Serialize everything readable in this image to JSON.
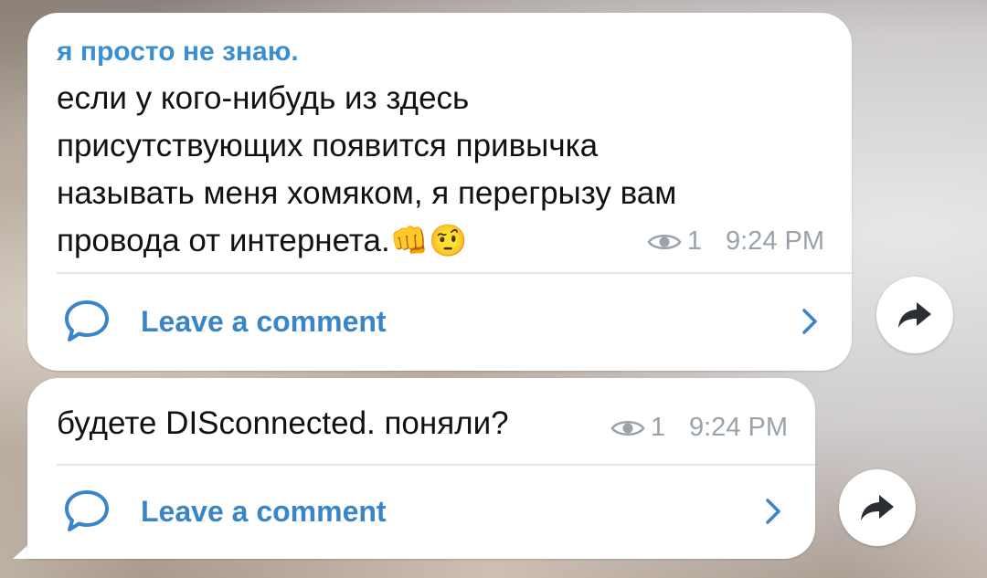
{
  "colors": {
    "author": "#3b8fd1",
    "link": "#3a85c7",
    "meta": "#9aa3ab",
    "bubble": "#ffffff",
    "text": "#111111"
  },
  "messages": [
    {
      "author": "я просто не знаю.",
      "lines": [
        "если у кого-нибудь из здесь",
        "присутствующих появится привычка",
        "называть меня хомяком, я перегрызу вам",
        "провода от интернета."
      ],
      "emojis": "👊🤨",
      "views": "1",
      "time": "9:24 PM",
      "comment_label": "Leave a comment",
      "icons": [
        "eye-icon",
        "comment-icon",
        "chevron-right-icon",
        "share-arrow-icon"
      ]
    },
    {
      "text": "будете DISconnected. поняли?",
      "views": "1",
      "time": "9:24 PM",
      "comment_label": "Leave a comment",
      "icons": [
        "eye-icon",
        "comment-icon",
        "chevron-right-icon",
        "share-arrow-icon"
      ]
    }
  ]
}
